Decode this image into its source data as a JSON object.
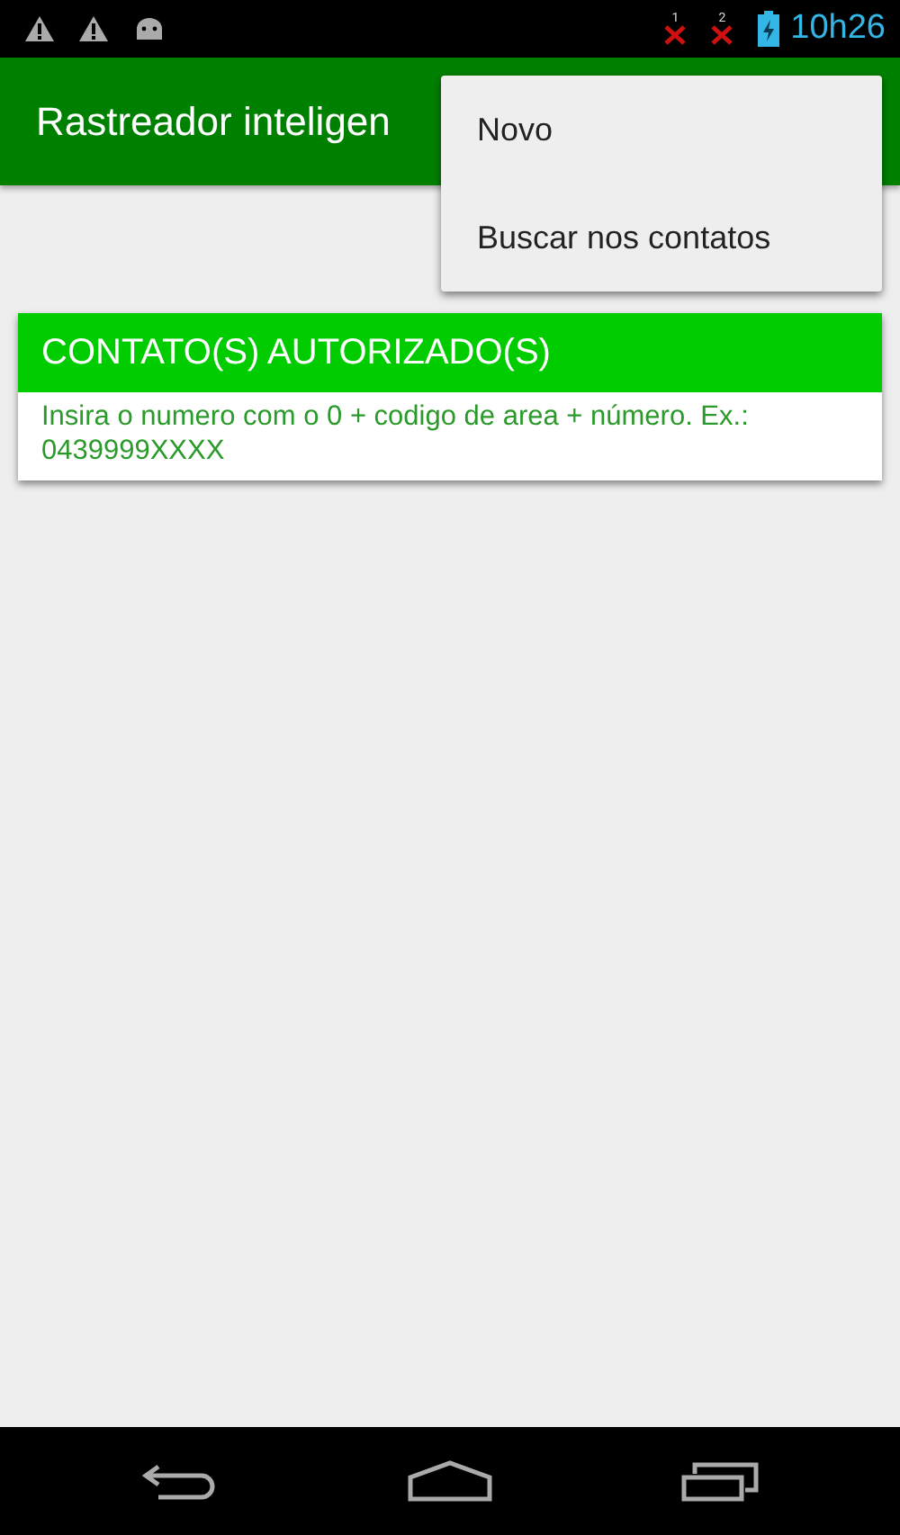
{
  "status_bar": {
    "sims": [
      {
        "label": "1"
      },
      {
        "label": "2"
      }
    ],
    "time": "10h26"
  },
  "app_bar": {
    "title": "Rastreador inteligen"
  },
  "menu": {
    "items": [
      {
        "label": "Novo"
      },
      {
        "label": "Buscar nos contatos"
      }
    ]
  },
  "card": {
    "title": "CONTATO(S) AUTORIZADO(S)",
    "hint": "Insira o numero com o 0 + codigo de area + número. Ex.: 0439999XXXX"
  }
}
